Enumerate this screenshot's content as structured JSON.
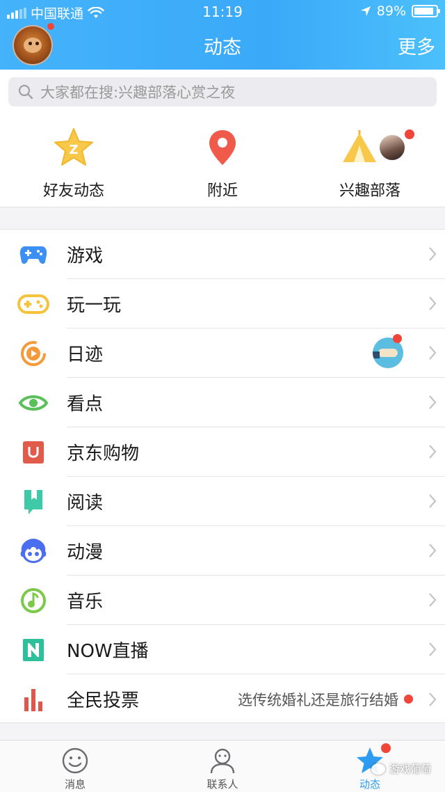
{
  "status_bar": {
    "carrier": "中国联通",
    "time": "11:19",
    "battery": "89%",
    "battery_level": 0.89
  },
  "header": {
    "title": "动态",
    "more": "更多"
  },
  "search": {
    "placeholder": "大家都在搜:兴趣部落心赏之夜"
  },
  "quick_items": [
    {
      "label": "好友动态",
      "icon": "friends-star-icon"
    },
    {
      "label": "附近",
      "icon": "location-pin-icon"
    },
    {
      "label": "兴趣部落",
      "icon": "tent-icon"
    }
  ],
  "menu": [
    {
      "label": "游戏",
      "icon": "gamepad-icon",
      "color": "#3b8ff5"
    },
    {
      "label": "玩一玩",
      "icon": "mini-game-icon",
      "color": "#f6c23c"
    },
    {
      "label": "日迹",
      "icon": "play-circle-icon",
      "color": "#f59a3b"
    },
    {
      "label": "看点",
      "icon": "eye-icon",
      "color": "#5ac05a"
    },
    {
      "label": "京东购物",
      "icon": "shopping-bag-icon",
      "color": "#e25a4a"
    },
    {
      "label": "阅读",
      "icon": "book-icon",
      "color": "#3ec9a7"
    },
    {
      "label": "动漫",
      "icon": "anime-face-icon",
      "color": "#4a6ef0"
    },
    {
      "label": "音乐",
      "icon": "music-note-icon",
      "color": "#7cc94a"
    },
    {
      "label": "NOW直播",
      "icon": "now-live-icon",
      "color": "#2ec09a"
    },
    {
      "label": "全民投票",
      "icon": "bar-chart-icon",
      "color": "#e2554a",
      "extra": "选传统婚礼还是旅行结婚"
    }
  ],
  "tabs": [
    {
      "label": "消息",
      "icon": "smile-icon"
    },
    {
      "label": "联系人",
      "icon": "contact-icon"
    },
    {
      "label": "动态",
      "icon": "star-icon"
    }
  ],
  "watermark": "游戏葡萄",
  "colors": {
    "header_start": "#45b3fb",
    "accent": "#2d9cf0",
    "badge": "#f0453a"
  }
}
